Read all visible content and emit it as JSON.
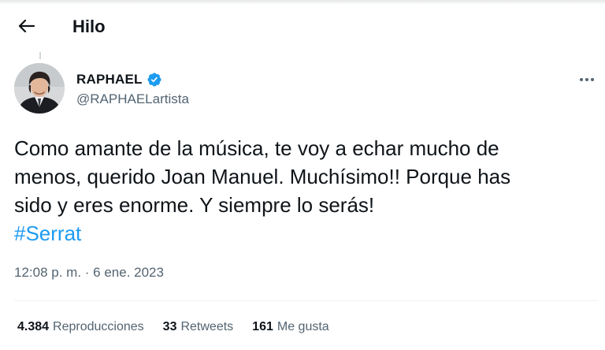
{
  "header": {
    "back_icon": "arrow-left-icon",
    "title": "Hilo"
  },
  "tweet": {
    "author": {
      "name": "RAPHAEL",
      "verified": true,
      "verified_color": "#1d9bf0",
      "handle": "@RAPHAELartista",
      "avatar_icon": "profile-photo"
    },
    "more_icon": "more-horizontal-icon",
    "text_lines": [
      "Como amante de la música, te voy a echar mucho de",
      "menos, querido Joan Manuel. Muchísimo!! Porque has",
      "sido y eres enorme. Y siempre lo serás!"
    ],
    "hashtag": "#Serrat",
    "hashtag_color": "#1d9bf0",
    "timestamp": "12:08 p. m. · 6 ene. 2023"
  },
  "stats": [
    {
      "count": "4.384",
      "label": "Reproducciones"
    },
    {
      "count": "33",
      "label": "Retweets"
    },
    {
      "count": "161",
      "label": "Me gusta"
    }
  ]
}
